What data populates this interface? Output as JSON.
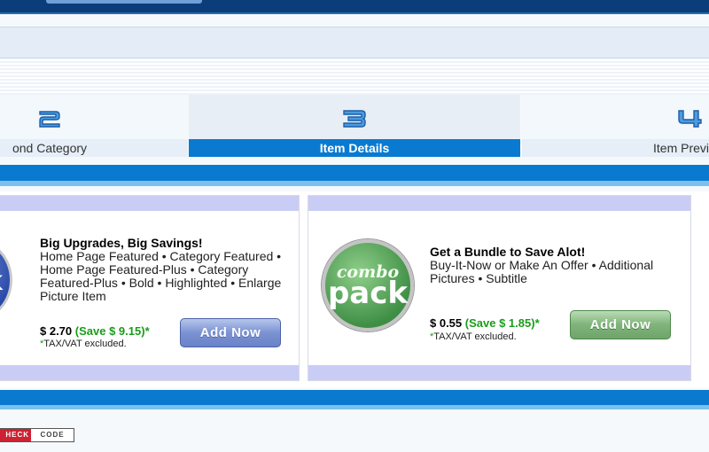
{
  "steps": [
    {
      "number": "2",
      "label": "ond Category"
    },
    {
      "number": "3",
      "label": "Item Details",
      "active": true
    },
    {
      "number": "4",
      "label": "Item Previ"
    }
  ],
  "offers": [
    {
      "title": "Big Upgrades, Big Savings!",
      "description": "Home Page Featured • Category Featured • Home Page Featured-Plus • Category Featured-Plus • Bold • Highlighted • Enlarge Picture Item",
      "price": "$ 2.70",
      "save": "(Save $ 9.15)",
      "price_star": "*",
      "tax_star": "*",
      "tax_note": "TAX/VAT excluded.",
      "button": "Add Now",
      "badge_text": "k",
      "badge_icon": "upgrade-badge-icon"
    },
    {
      "title": "Get a Bundle to Save Alot!",
      "description": "Buy-It-Now or Make An Offer • Additional Pictures • Subtitle",
      "price": "$ 0.55",
      "save": "(Save $ 1.85)",
      "price_star": "*",
      "tax_star": "*",
      "tax_note": "TAX/VAT excluded.",
      "button": "Add Now",
      "badge_line1": "combo",
      "badge_line2": "pack",
      "badge_icon": "combo-pack-badge-icon"
    }
  ],
  "footer": {
    "check_label": "HECK",
    "code_label": "CODE"
  },
  "colors": {
    "header_dark": "#0a3d7a",
    "active_step": "#0a7ad0",
    "band": "#c9cdf6",
    "save_green": "#1a9c1a"
  }
}
